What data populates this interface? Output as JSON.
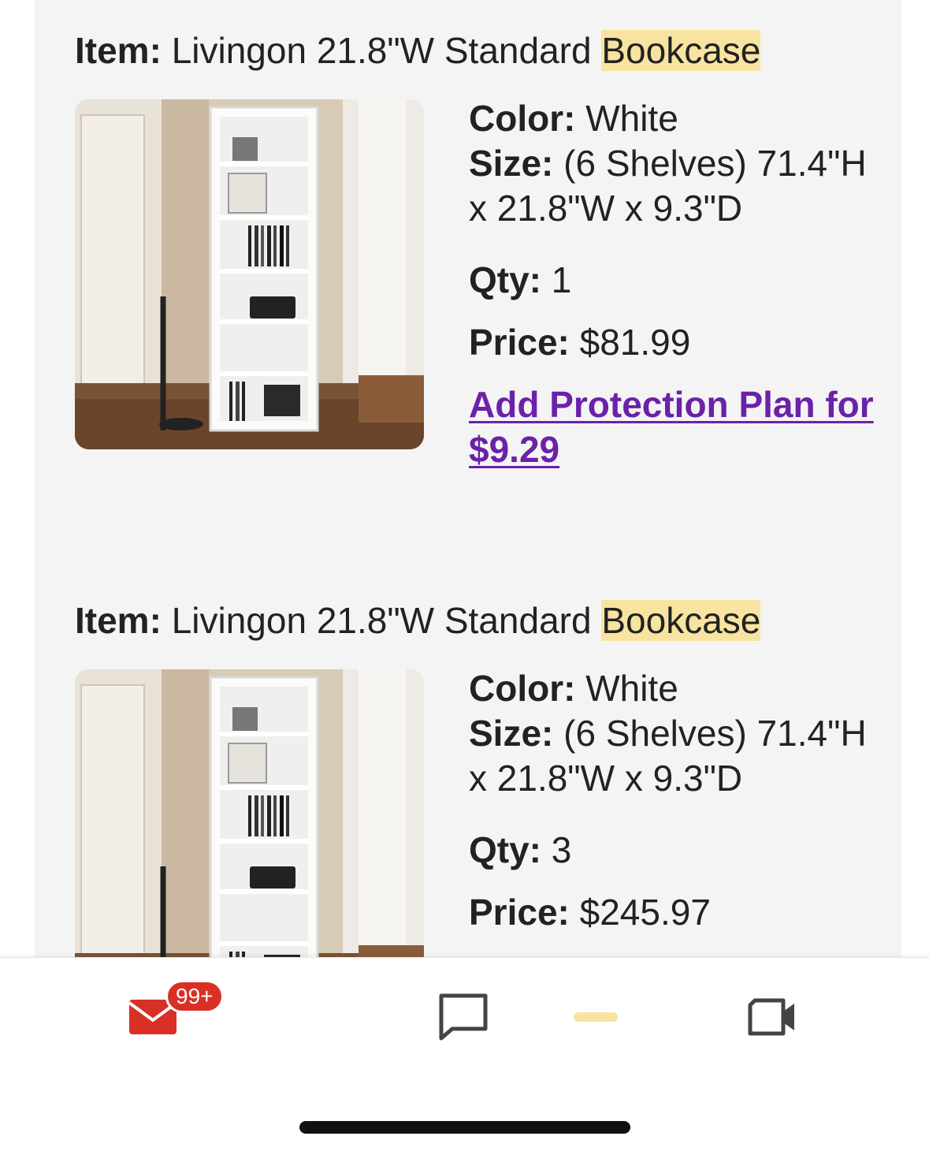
{
  "items": [
    {
      "item_label": "Item:",
      "title_prefix": "Livingon 21.8\"W Standard ",
      "title_highlight": "Bookcase",
      "color_label": "Color:",
      "color_value": "White",
      "size_label": "Size:",
      "size_value": "(6 Shelves) 71.4\"H x 21.8\"W x 9.3\"D",
      "qty_label": "Qty:",
      "qty_value": "1",
      "price_label": "Price:",
      "price_value": "$81.99",
      "protection_link": "Add Protection Plan for $9.29"
    },
    {
      "item_label": "Item:",
      "title_prefix": "Livingon 21.8\"W Standard ",
      "title_highlight": "Bookcase",
      "color_label": "Color:",
      "color_value": "White",
      "size_label": "Size:",
      "size_value": "(6 Shelves) 71.4\"H x 21.8\"W x 9.3\"D",
      "qty_label": "Qty:",
      "qty_value": "3",
      "price_label": "Price:",
      "price_value": "$245.97"
    }
  ],
  "bottom_nav": {
    "mail_badge": "99+",
    "icons": [
      "mail-icon",
      "chat-icon",
      "spaces-icon",
      "video-icon"
    ]
  },
  "colors": {
    "highlight": "#f8e4a0",
    "link": "#6b21a8",
    "badge": "#d93025",
    "card_bg": "#f4f4f4"
  }
}
